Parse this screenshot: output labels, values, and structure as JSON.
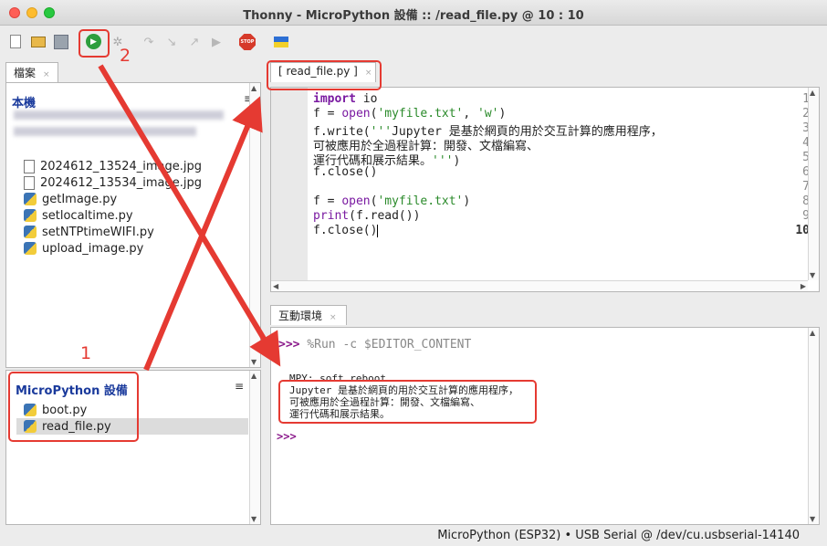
{
  "window": {
    "title": "Thonny  -  MicroPython 設備 :: /read_file.py  @  10 : 10"
  },
  "toolbar": {
    "icons": [
      "new-file-icon",
      "open-file-icon",
      "save-icon",
      "run-icon",
      "debug-icon",
      "step-over-icon",
      "step-into-icon",
      "step-out-icon",
      "resume-icon",
      "stop-icon",
      "ukraine-flag-icon"
    ],
    "stop_label": "STOP"
  },
  "files_pane": {
    "tab_label": "檔案",
    "local_section": "本機",
    "local_files": [
      "2024612_13524_image.jpg",
      "2024612_13534_image.jpg",
      "getImage.py",
      "setlocaltime.py",
      "setNTPtimeWIFI.py",
      "upload_image.py"
    ],
    "device_section": "MicroPython 設備",
    "device_files": [
      "boot.py",
      "read_file.py"
    ]
  },
  "editor": {
    "tab_label": "[ read_file.py ]",
    "lines": [
      {
        "n": "1",
        "text": "import io"
      },
      {
        "n": "2",
        "text": "f = open('myfile.txt', 'w')"
      },
      {
        "n": "3",
        "text": "f.write('''Jupyter 是基於網頁的用於交互計算的應用程序，"
      },
      {
        "n": "4",
        "text": "可被應用於全過程計算：開發、文檔編寫、"
      },
      {
        "n": "5",
        "text": "運行代碼和展示結果。''')"
      },
      {
        "n": "6",
        "text": "f.close()"
      },
      {
        "n": "7",
        "text": ""
      },
      {
        "n": "8",
        "text": "f = open('myfile.txt')"
      },
      {
        "n": "9",
        "text": "print(f.read())"
      },
      {
        "n": "10",
        "text": "f.close()"
      }
    ]
  },
  "shell": {
    "tab_label": "互動環境",
    "prompt": ">>>",
    "command": "%Run -c $EDITOR_CONTENT",
    "soft_reboot": "MPY: soft reboot",
    "output": [
      "Jupyter 是基於網頁的用於交互計算的應用程序，",
      "可被應用於全過程計算：開發、文檔編寫、",
      "運行代碼和展示結果。"
    ]
  },
  "statusbar": {
    "text": "MicroPython (ESP32)  •  USB Serial @ /dev/cu.usbserial-14140"
  },
  "annotations": {
    "label_1": "1",
    "label_2": "2",
    "color": "#e53a32"
  }
}
